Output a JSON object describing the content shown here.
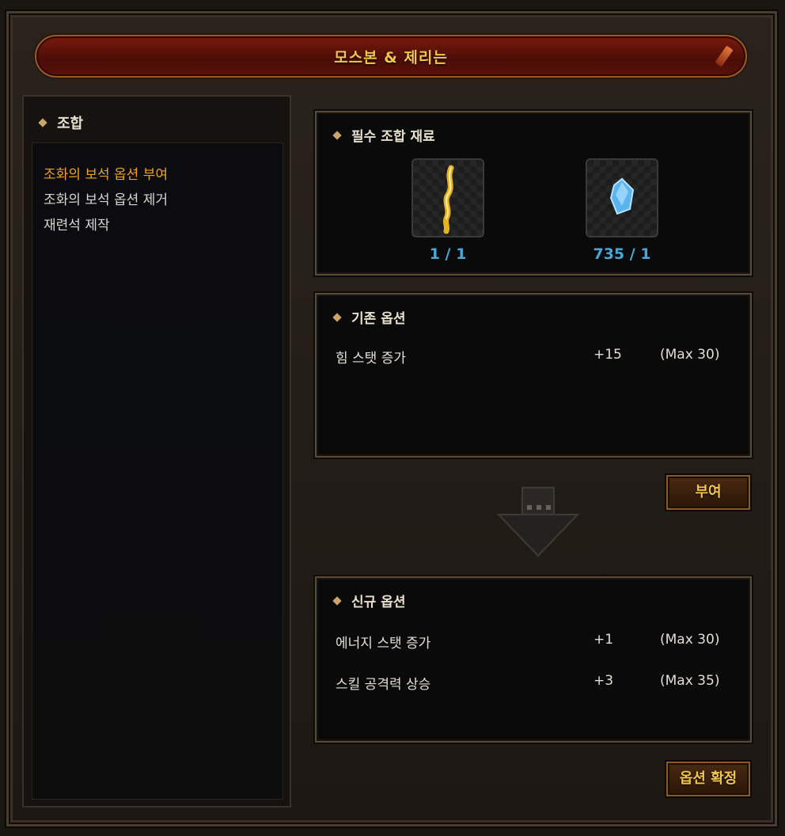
{
  "window": {
    "title": "모스본 & 제리는"
  },
  "sidebar": {
    "header": "조합",
    "items": [
      {
        "label": "조화의 보석 옵션 부여",
        "active": true
      },
      {
        "label": "조화의 보석 옵션 제거",
        "active": false
      },
      {
        "label": "재련석 제작",
        "active": false
      }
    ]
  },
  "materials": {
    "header": "필수 조합 재료",
    "items": [
      {
        "icon": "gold-horn-icon",
        "count": "1 / 1"
      },
      {
        "icon": "blue-jewel-icon",
        "count": "735 / 1"
      }
    ]
  },
  "existing_options": {
    "header": "기존 옵션",
    "rows": [
      {
        "name": "힘 스탯 증가",
        "value": "+15",
        "max": "(Max 30)"
      }
    ]
  },
  "grant_button": "부여",
  "new_options": {
    "header": "신규 옵션",
    "rows": [
      {
        "name": "에너지 스탯 증가",
        "value": "+1",
        "max": "(Max 30)"
      },
      {
        "name": "스킬 공격력 상승",
        "value": "+3",
        "max": "(Max 35)"
      }
    ]
  },
  "confirm_button": "옵션 확정",
  "colors": {
    "accent_gold": "#f2c64a",
    "active_item": "#f0a21e",
    "count_blue": "#4aa6d6",
    "title_red": "#7a1a0e"
  }
}
